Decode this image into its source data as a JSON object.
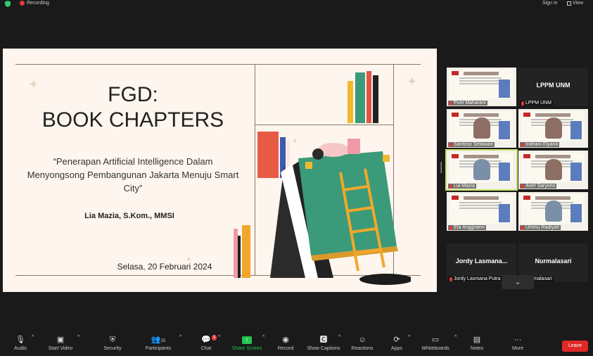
{
  "topbar": {
    "recording_label": "Recording",
    "sign_in_label": "Sign in",
    "view_label": "View"
  },
  "slide": {
    "title_line1": "FGD:",
    "title_line2": "BOOK CHAPTERS",
    "subtitle": "“Penerapan Artificial Intelligence Dalam Menyongsong Pembangunan Jakarta Menuju Smart City”",
    "author": "Lia Mazia, S.Kom., MMSI",
    "date": "Selasa, 20 Februari 2024"
  },
  "participants": [
    {
      "name": "Putri Maharani",
      "kind": "slide"
    },
    {
      "name": "LPPM UNM",
      "big": "LPPM UNM",
      "kind": "dark"
    },
    {
      "name": "Santoso Setiawan",
      "kind": "face"
    },
    {
      "name": "Indriani Elyana",
      "kind": "face"
    },
    {
      "name": "Lia Mazia",
      "kind": "face-hijab",
      "active": true
    },
    {
      "name": "Arief Saryono",
      "kind": "face"
    },
    {
      "name": "Eta Anggraeni",
      "kind": "slide"
    },
    {
      "name": "Ummu Radiyah",
      "kind": "face-hijab"
    },
    {
      "name": "Jordy Lasmana Putra",
      "big": "Jordy Lasmana...",
      "kind": "dark"
    },
    {
      "name": "Nurmalasari",
      "big": "Nurmalasari",
      "kind": "dark"
    }
  ],
  "toolbar": {
    "audio": "Audio",
    "start_video": "Start Video",
    "security": "Security",
    "participants": "Participants",
    "participants_count": "25",
    "chat": "Chat",
    "chat_badge": "3",
    "share_screen": "Share Screen",
    "record": "Record",
    "show_captions": "Show Captions",
    "reactions": "Reactions",
    "apps": "Apps",
    "whiteboards": "Whiteboards",
    "notes": "Notes",
    "more": "More",
    "leave": "Leave"
  },
  "colors": {
    "accent_green": "#23c552",
    "leave_red": "#e02828",
    "slide_bg": "#fdf5ee",
    "active_speaker": "#c6e06a"
  },
  "icons": [
    "shield-icon",
    "record-dot-icon",
    "view-grid-icon",
    "mic-muted-icon",
    "video-off-icon",
    "security-shield-icon",
    "participants-icon",
    "chat-icon",
    "share-screen-icon",
    "record-icon",
    "captions-icon",
    "reactions-icon",
    "apps-icon",
    "whiteboard-icon",
    "notes-icon",
    "more-icon",
    "chevron-down-icon"
  ]
}
